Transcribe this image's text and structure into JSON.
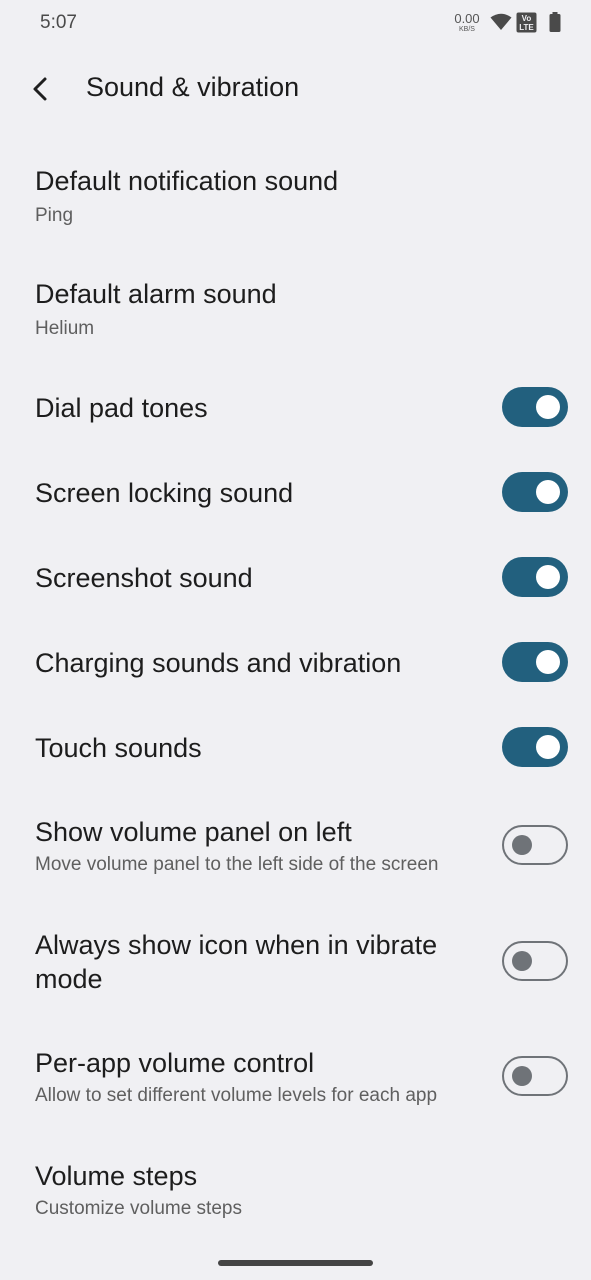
{
  "status": {
    "time": "5:07",
    "net_speed_value": "0.00",
    "net_speed_unit": "KB/S",
    "lte_top": "Vo",
    "lte_bottom": "LTE"
  },
  "header": {
    "title": "Sound & vibration"
  },
  "settings": [
    {
      "title": "Default notification sound",
      "subtitle": "Ping"
    },
    {
      "title": "Default alarm sound",
      "subtitle": "Helium"
    },
    {
      "title": "Dial pad tones",
      "toggle": true
    },
    {
      "title": "Screen locking sound",
      "toggle": true
    },
    {
      "title": "Screenshot sound",
      "toggle": true
    },
    {
      "title": "Charging sounds and vibration",
      "toggle": true
    },
    {
      "title": "Touch sounds",
      "toggle": true
    },
    {
      "title": "Show volume panel on left",
      "subtitle": "Move volume panel to the left side of the screen",
      "toggle": false
    },
    {
      "title_line1": "Always show icon when in vibrate",
      "title_line2": "mode",
      "toggle": false
    },
    {
      "title": "Per-app volume control",
      "subtitle": "Allow to set different volume levels for each app",
      "toggle": false
    },
    {
      "title": "Volume steps",
      "subtitle": "Customize volume steps"
    }
  ],
  "colors": {
    "toggle_on": "#22607e",
    "toggle_off_outline": "#6f7378",
    "background": "#f0f0f3"
  }
}
